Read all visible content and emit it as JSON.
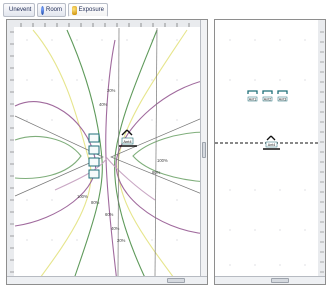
{
  "tabs": [
    {
      "label": "Unevent",
      "icon": "blue-circle-icon"
    },
    {
      "label": "Room",
      "icon": "blue-circle-icon"
    },
    {
      "label": "Exposure",
      "icon": "sun-icon"
    }
  ],
  "left_view": {
    "contour_labels": [
      "20%",
      "40%",
      "100%",
      "80%",
      "100%",
      "80%",
      "60%",
      "40%",
      "20%"
    ],
    "antenna_labels": [
      "Ant4"
    ]
  },
  "right_view": {
    "antenna_labels": [
      "Ant1",
      "Ant2",
      "Ant3",
      "Ant4"
    ]
  },
  "colors": {
    "contour_green": "#5f9a5b",
    "contour_purple": "#a06a9d",
    "contour_yellow": "#e6e58c",
    "antenna_teal": "#1f6f78"
  }
}
